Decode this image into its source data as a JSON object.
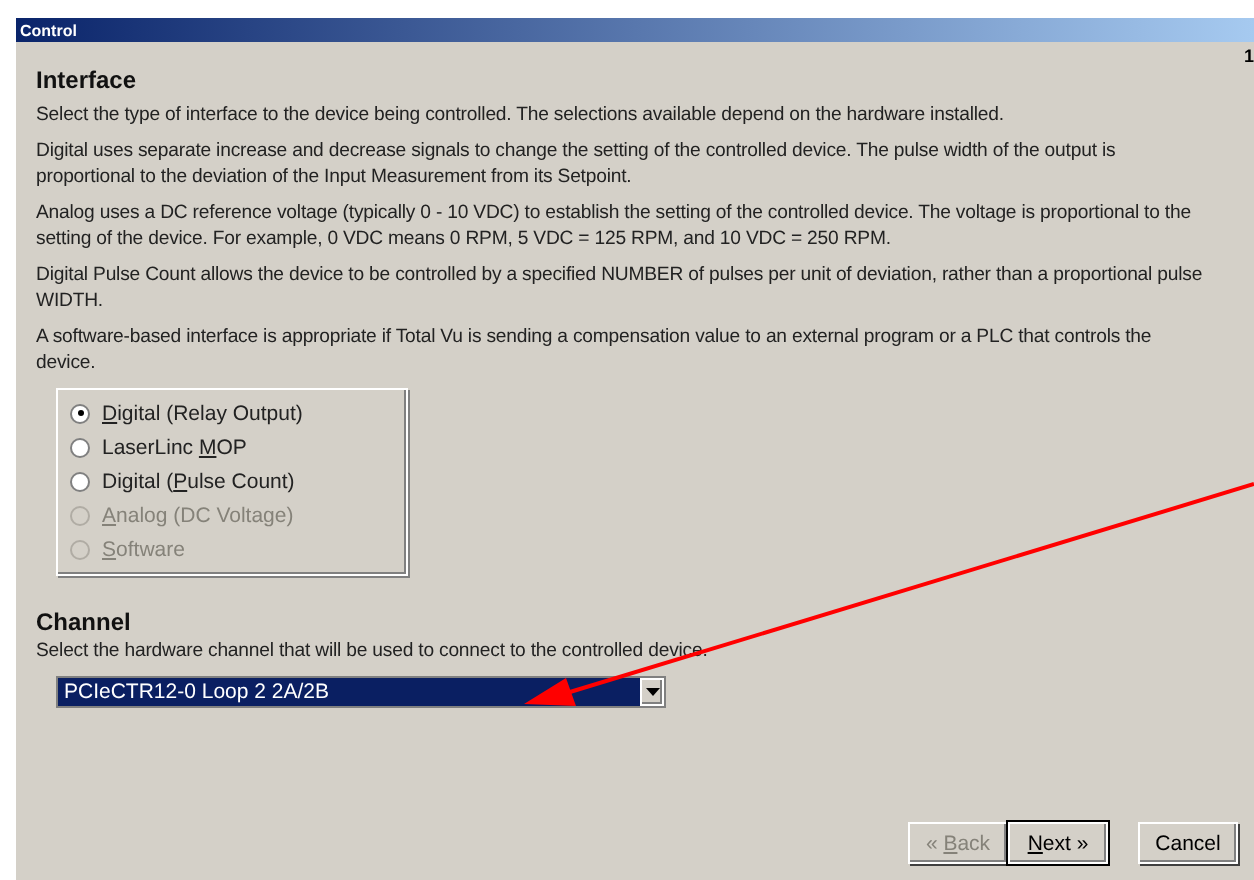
{
  "window": {
    "title": "Control",
    "corner_text": "1"
  },
  "interface": {
    "heading": "Interface",
    "paragraphs": [
      "Select the type of interface to the device being controlled.  The selections available depend on the hardware installed.",
      "Digital uses separate increase and decrease signals to change the setting of the controlled device.  The pulse width of the output is proportional to the deviation of the Input Measurement from its Setpoint.",
      "Analog uses a DC reference voltage (typically 0 - 10 VDC) to establish the setting of the controlled device.  The voltage is proportional to the setting of the device.  For example, 0 VDC means 0 RPM, 5 VDC = 125 RPM, and 10 VDC = 250 RPM.",
      "Digital Pulse Count allows the device to be controlled by a specified NUMBER of pulses per unit of deviation, rather than a proportional pulse WIDTH.",
      "A software-based interface is appropriate if Total Vu is sending a compensation value to an external program or a PLC that controls the device."
    ],
    "options": [
      {
        "label": {
          "key": "D",
          "text": "igital (Relay Output)"
        },
        "selected": true,
        "disabled": false
      },
      {
        "label": {
          "pre": "LaserLinc ",
          "key": "M",
          "text": "OP"
        },
        "selected": false,
        "disabled": false
      },
      {
        "label": {
          "pre": "Digital (",
          "key": "P",
          "text": "ulse Count)"
        },
        "selected": false,
        "disabled": false
      },
      {
        "label": {
          "key": "A",
          "text": "nalog (DC Voltage)"
        },
        "selected": false,
        "disabled": true
      },
      {
        "label": {
          "key": "S",
          "text": "oftware"
        },
        "selected": false,
        "disabled": true
      }
    ]
  },
  "channel": {
    "heading": "Channel",
    "description": "Select the hardware channel that will be used to connect to the controlled device.",
    "value": "PCIeCTR12-0 Loop 2 2A/2B"
  },
  "buttons": [
    {
      "label": {
        "pre": "« ",
        "key": "B",
        "text": "ack"
      },
      "disabled": true,
      "default": false
    },
    {
      "label": {
        "key": "N",
        "text": "ext »"
      },
      "disabled": false,
      "default": true
    },
    {
      "label": {
        "text": "Cancel"
      },
      "disabled": false,
      "default": false
    }
  ]
}
